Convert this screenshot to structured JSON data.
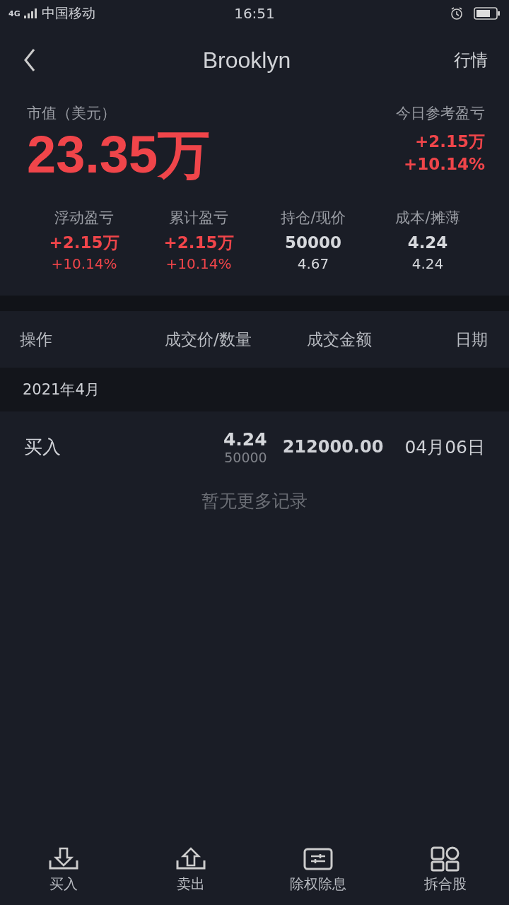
{
  "status_bar": {
    "network": "4G",
    "carrier": "中国移动",
    "time": "16:51"
  },
  "nav": {
    "title": "Brooklyn",
    "action": "行情"
  },
  "summary": {
    "label": "市值（美元）",
    "value": "23.35万",
    "today_label": "今日参考盈亏",
    "today_amount": "+2.15万",
    "today_percent": "+10.14%"
  },
  "stats": [
    {
      "label": "浮动盈亏",
      "lines": [
        {
          "text": "+2.15万",
          "kind": "gain"
        },
        {
          "text": "+10.14%",
          "kind": "gain"
        }
      ]
    },
    {
      "label": "累计盈亏",
      "lines": [
        {
          "text": "+2.15万",
          "kind": "gain"
        },
        {
          "text": "+10.14%",
          "kind": "gain"
        }
      ]
    },
    {
      "label": "持仓/现价",
      "lines": [
        {
          "text": "50000",
          "kind": "plain"
        },
        {
          "text": "4.67",
          "kind": "plain"
        }
      ]
    },
    {
      "label": "成本/摊薄",
      "lines": [
        {
          "text": "4.24",
          "kind": "plain"
        },
        {
          "text": "4.24",
          "kind": "plain"
        }
      ]
    }
  ],
  "table": {
    "columns": [
      "操作",
      "成交价/数量",
      "成交金额",
      "日期"
    ],
    "groups": [
      {
        "title": "2021年4月",
        "rows": [
          {
            "action": "买入",
            "price": "4.24",
            "quantity": "50000",
            "amount": "212000.00",
            "date": "04月06日"
          }
        ]
      }
    ],
    "empty_text": "暂无更多记录"
  },
  "toolbar": [
    {
      "label": "买入",
      "kind": "buy"
    },
    {
      "label": "卖出",
      "kind": "sell"
    },
    {
      "label": "除权除息",
      "kind": "dividend"
    },
    {
      "label": "拆合股",
      "kind": "split"
    }
  ]
}
